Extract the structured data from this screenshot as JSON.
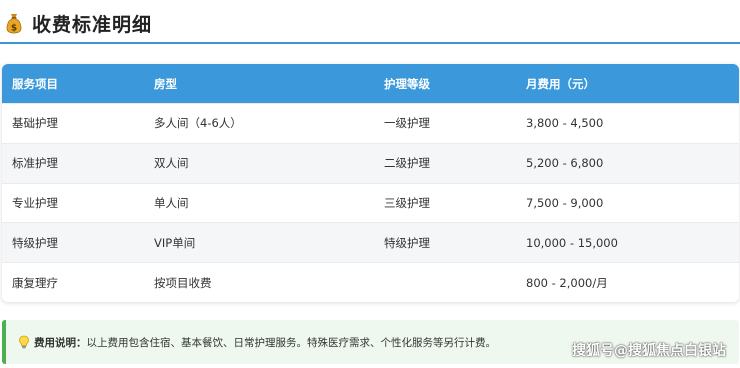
{
  "page": {
    "title": "收费标准明细",
    "title_icon": "money-bag-icon"
  },
  "table": {
    "headers": [
      "服务项目",
      "房型",
      "护理等级",
      "月费用（元）"
    ],
    "rows": [
      [
        "基础护理",
        "多人间（4-6人）",
        "一级护理",
        "3,800 - 4,500"
      ],
      [
        "标准护理",
        "双人间",
        "二级护理",
        "5,200 - 6,800"
      ],
      [
        "专业护理",
        "单人间",
        "三级护理",
        "7,500 - 9,000"
      ],
      [
        "特级护理",
        "VIP单间",
        "特级护理",
        "10,000 - 15,000"
      ],
      [
        "康复理疗",
        "按项目收费",
        "",
        "800 - 2,000/月"
      ]
    ]
  },
  "note": {
    "icon": "lightbulb-icon",
    "label": "费用说明：",
    "text": "以上费用包含住宿、基本餐饮、日常护理服务。特殊医疗需求、个性化服务等另行计费。"
  },
  "watermark": "搜狐号@搜狐焦点白银站",
  "colors": {
    "accent": "#3a98db",
    "note_bg": "#eef8ee",
    "note_border": "#4caf50"
  }
}
